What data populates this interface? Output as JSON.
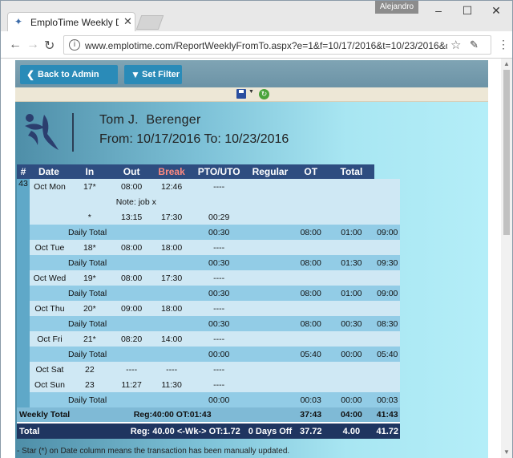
{
  "browser": {
    "tab_title": "EmploTime Weekly Date",
    "user": "Alejandro",
    "url": "www.emplotime.com/ReportWeeklyFromTo.aspx?e=1&f=10/17/2016&t=10/23/2016&d=tru"
  },
  "toolbar": {
    "back_label": "Back to Admin Portal",
    "filter_label": "Set Filter"
  },
  "report": {
    "employee": "Tom J.  Berenger",
    "range": "From: 10/17/2016 To: 10/23/2016",
    "week": "43",
    "headers": [
      "#",
      "Date",
      "In",
      "Out",
      "Break",
      "PTO/UTO",
      "Regular",
      "OT",
      "Total"
    ],
    "rows": [
      {
        "kind": "a",
        "date": "Oct Mon",
        "day": "17*",
        "in": "08:00",
        "out": "12:46",
        "brk": "----",
        "reg": "",
        "ot": "",
        "total": ""
      },
      {
        "kind": "a",
        "date": "",
        "day": "",
        "in": "Note: job x",
        "out": "",
        "brk": "",
        "reg": "",
        "ot": "",
        "total": ""
      },
      {
        "kind": "a",
        "date": "",
        "day": "*",
        "in": "13:15",
        "out": "17:30",
        "brk": "00:29",
        "reg": "",
        "ot": "",
        "total": ""
      },
      {
        "kind": "b",
        "date": "",
        "day": "Daily Total",
        "in": "",
        "out": "",
        "brk": "00:30",
        "reg": "08:00",
        "ot": "01:00",
        "total": "09:00"
      },
      {
        "kind": "a",
        "date": "Oct Tue",
        "day": "18*",
        "in": "08:00",
        "out": "18:00",
        "brk": "----",
        "reg": "",
        "ot": "",
        "total": ""
      },
      {
        "kind": "b",
        "date": "",
        "day": "Daily Total",
        "in": "",
        "out": "",
        "brk": "00:30",
        "reg": "08:00",
        "ot": "01:30",
        "total": "09:30"
      },
      {
        "kind": "a",
        "date": "Oct Wed",
        "day": "19*",
        "in": "08:00",
        "out": "17:30",
        "brk": "----",
        "reg": "",
        "ot": "",
        "total": ""
      },
      {
        "kind": "b",
        "date": "",
        "day": "Daily Total",
        "in": "",
        "out": "",
        "brk": "00:30",
        "reg": "08:00",
        "ot": "01:00",
        "total": "09:00"
      },
      {
        "kind": "a",
        "date": "Oct Thu",
        "day": "20*",
        "in": "09:00",
        "out": "18:00",
        "brk": "----",
        "reg": "",
        "ot": "",
        "total": ""
      },
      {
        "kind": "b",
        "date": "",
        "day": "Daily Total",
        "in": "",
        "out": "",
        "brk": "00:30",
        "reg": "08:00",
        "ot": "00:30",
        "total": "08:30"
      },
      {
        "kind": "a",
        "date": "Oct Fri",
        "day": "21*",
        "in": "08:20",
        "out": "14:00",
        "brk": "----",
        "reg": "",
        "ot": "",
        "total": ""
      },
      {
        "kind": "b",
        "date": "",
        "day": "Daily Total",
        "in": "",
        "out": "",
        "brk": "00:00",
        "reg": "05:40",
        "ot": "00:00",
        "total": "05:40"
      },
      {
        "kind": "a",
        "date": "Oct Sat",
        "day": "22",
        "in": "----",
        "out": "----",
        "brk": "----",
        "reg": "",
        "ot": "",
        "total": ""
      },
      {
        "kind": "a",
        "date": "Oct Sun",
        "day": "23",
        "in": "11:27",
        "out": "11:30",
        "brk": "----",
        "reg": "",
        "ot": "",
        "total": ""
      },
      {
        "kind": "b",
        "date": "",
        "day": "Daily Total",
        "in": "",
        "out": "",
        "brk": "00:00",
        "reg": "00:03",
        "ot": "00:00",
        "total": "00:03"
      }
    ],
    "weekly": {
      "label": "Weekly Total",
      "summary": "Reg:40:00 OT:01:43",
      "reg": "37:43",
      "ot": "04:00",
      "total": "41:43"
    },
    "grand": {
      "label": "Total",
      "summary": "Reg: 40.00 <-Wk-> OT:1.72",
      "pto": "0 Days Off",
      "reg": "37.72",
      "ot": "4.00",
      "total": "41.72"
    },
    "footnote": "- Star (*) on Date column means the transaction has been manually updated."
  }
}
